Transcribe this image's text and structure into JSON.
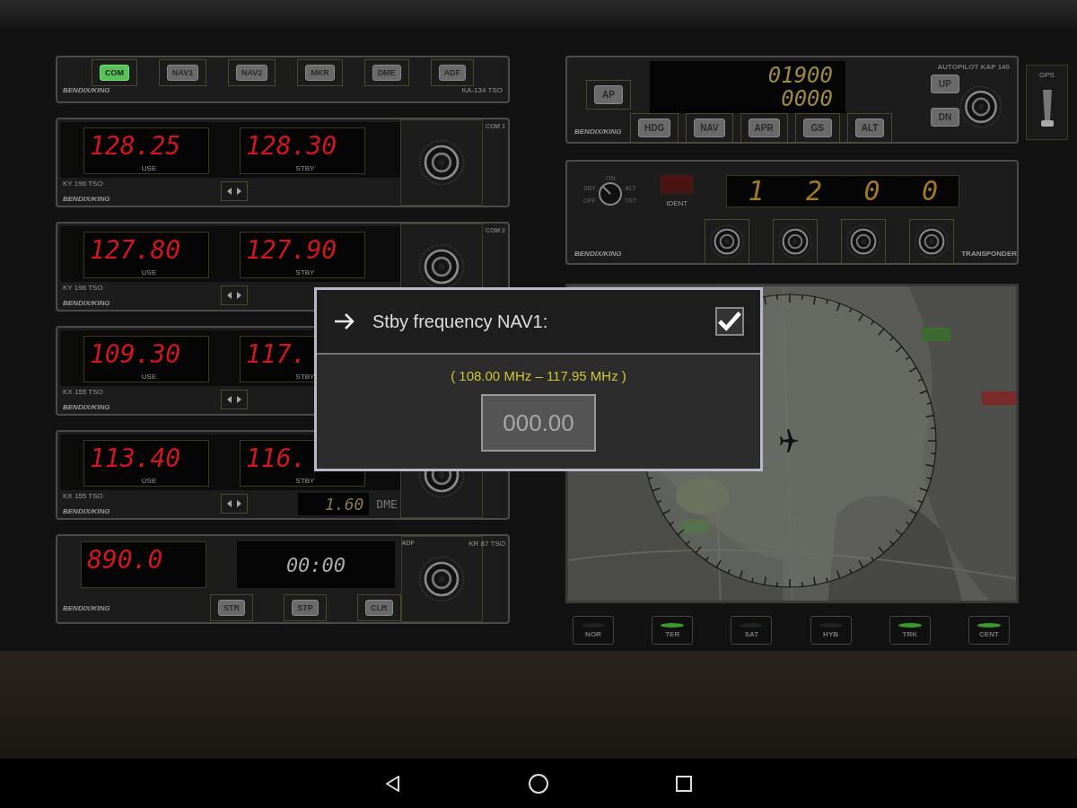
{
  "audio_panel": {
    "buttons": [
      {
        "label": "COM",
        "selected": true
      },
      {
        "label": "NAV1",
        "selected": false
      },
      {
        "label": "NAV2",
        "selected": false
      },
      {
        "label": "MKR",
        "selected": false
      },
      {
        "label": "DME",
        "selected": false
      },
      {
        "label": "ADF",
        "selected": false
      }
    ],
    "brand": "BENDIX/KING",
    "model": "KA-134 TSO"
  },
  "radios": [
    {
      "title": "COM 1",
      "model": "KY 196 TSO",
      "brand": "BENDIX/KING",
      "active": "128.25",
      "active_label": "USE",
      "standby": "128.30",
      "standby_label": "STBY"
    },
    {
      "title": "COM 2",
      "model": "KY 196 TSO",
      "brand": "BENDIX/KING",
      "active": "127.80",
      "active_label": "USE",
      "standby": "127.90",
      "standby_label": "STBY"
    },
    {
      "model": "KX 155 TSO",
      "brand": "BENDIX/KING",
      "active": "109.30",
      "active_label": "USE",
      "standby": "117.",
      "standby_label": "STBY"
    },
    {
      "model": "KX 155 TSO",
      "brand": "BENDIX/KING",
      "active": "113.40",
      "active_label": "USE",
      "standby": "116.",
      "standby_label": "STBY",
      "dme": {
        "value": "1.60",
        "label": "DME"
      }
    }
  ],
  "adf": {
    "title": "ADF",
    "model": "KR 87 TSO",
    "brand": "BENDIX/KING",
    "frequency": "890.0",
    "timer": "00:00",
    "buttons": [
      "STR",
      "STP",
      "CLR"
    ]
  },
  "autopilot": {
    "title": "AUTOPILOT KAP 140",
    "brand": "BENDIX/KING",
    "altitude": "01900",
    "vertical_speed": "0000",
    "ap_button": "AP",
    "mode_buttons": [
      "HDG",
      "NAV",
      "APR",
      "GS",
      "ALT"
    ],
    "trim_buttons": [
      "UP",
      "DN"
    ]
  },
  "gps_switch": {
    "label": "GPS",
    "on": false
  },
  "transponder": {
    "title": "TRANSPONDER",
    "brand": "BENDIX/KING",
    "mode_labels": [
      "OFF",
      "SBY",
      "ON",
      "ALT",
      "TST"
    ],
    "ident_label": "IDENT",
    "code": [
      "1",
      "2",
      "0",
      "0"
    ]
  },
  "map_modes": [
    {
      "label": "NOR",
      "on": false
    },
    {
      "label": "TER",
      "on": true
    },
    {
      "label": "SAT",
      "on": false
    },
    {
      "label": "HYB",
      "on": false
    },
    {
      "label": "TRK",
      "on": true
    },
    {
      "label": "CENT",
      "on": true
    }
  ],
  "dialog": {
    "title": "Stby frequency NAV1:",
    "checked": true,
    "range": "( 108.00 MHz – 117.95 MHz )",
    "placeholder": "000.00"
  }
}
